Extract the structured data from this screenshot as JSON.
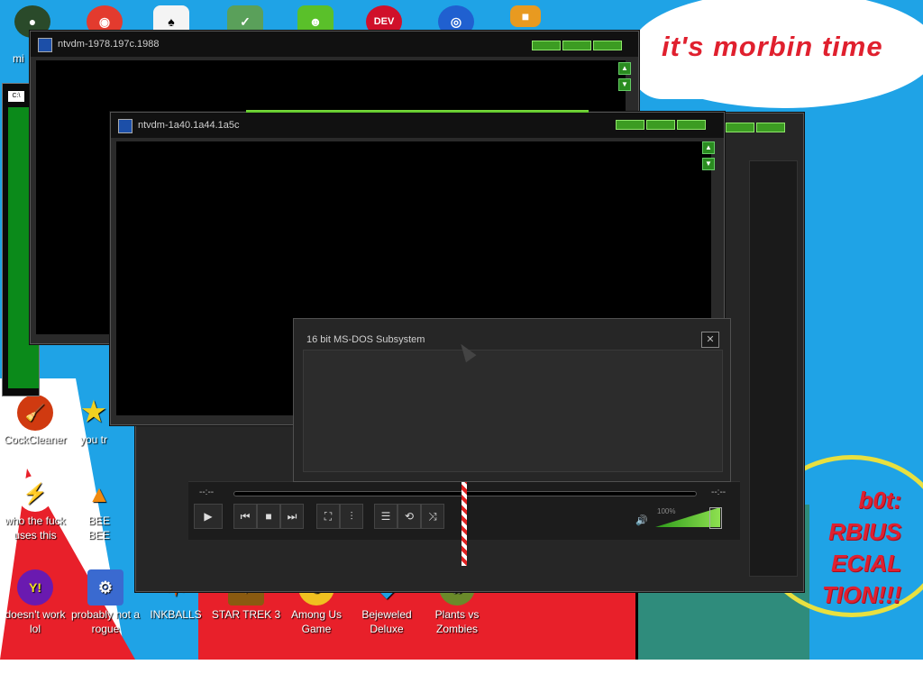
{
  "desktop": {
    "banner_text": "it's morbin time",
    "morbius_lines": [
      "b0t:",
      "RBIUS",
      "ECIAL",
      "TION!!!"
    ],
    "top_icons": [
      {
        "name": "mi",
        "color": "#2a4a2a",
        "glyph": "●"
      },
      {
        "name": "chrome",
        "color": "#e33b2e",
        "glyph": "◉"
      },
      {
        "name": "solitaire",
        "color": "#ffffff",
        "glyph": "♠"
      },
      {
        "name": "shield",
        "color": "#5aa05a",
        "glyph": "✓"
      },
      {
        "name": "angry-birds",
        "color": "#5ac02a",
        "glyph": "☻"
      },
      {
        "name": "dev",
        "color": "#d0102a",
        "glyph": "DEV"
      },
      {
        "name": "target",
        "color": "#2060d0",
        "glyph": "◎"
      },
      {
        "name": "box",
        "color": "#e89a20",
        "glyph": "■"
      }
    ],
    "mi_label": "mi",
    "icons": [
      {
        "label": "CockCleaner",
        "glyph": "🧹",
        "color": "#d03a10"
      },
      {
        "label": "you tr",
        "glyph": "★",
        "color": "#f0d020"
      },
      {
        "label": "who the fuck uses this",
        "glyph": "⚡",
        "color": "#f06a10"
      },
      {
        "label": "BEE BEE",
        "glyph": "▲",
        "color": "#f08a10"
      },
      {
        "label": "doesn't work lol",
        "glyph": "Y!",
        "color": "#6a1ab0"
      },
      {
        "label": "probably not a rogue",
        "glyph": "⚙",
        "color": "#3a6ad0"
      },
      {
        "label": "INKBALLS",
        "glyph": "✶",
        "color": "#e05a10"
      },
      {
        "label": "STAR TREK 3",
        "glyph": "✦",
        "color": "#8a5a10"
      },
      {
        "label": "Among Us Game",
        "glyph": "☻",
        "color": "#f0c020"
      },
      {
        "label": "Bejeweled Deluxe",
        "glyph": "◆",
        "color": "#20a0e0"
      },
      {
        "label": "Plants vs Zombies",
        "glyph": "✿",
        "color": "#6a8a2a"
      }
    ]
  },
  "windows": {
    "back_title": "ntvdm-1978.197c.1988",
    "front_title": "ntvdm-1a40.1a44.1a5c",
    "console_icon": "C:\\"
  },
  "dialog": {
    "title": "16 bit MS-DOS Subsystem",
    "close": "✕"
  },
  "player": {
    "time_left": "--:--",
    "time_right": "--:--",
    "volume_pct": "100%",
    "buttons": {
      "play": "▶",
      "prev": "⏮",
      "stop": "■",
      "next": "⏭",
      "fullscreen": "⛶",
      "eq": "⫶",
      "playlist": "☰",
      "repeat": "⟲",
      "shuffle": "⤨"
    }
  }
}
